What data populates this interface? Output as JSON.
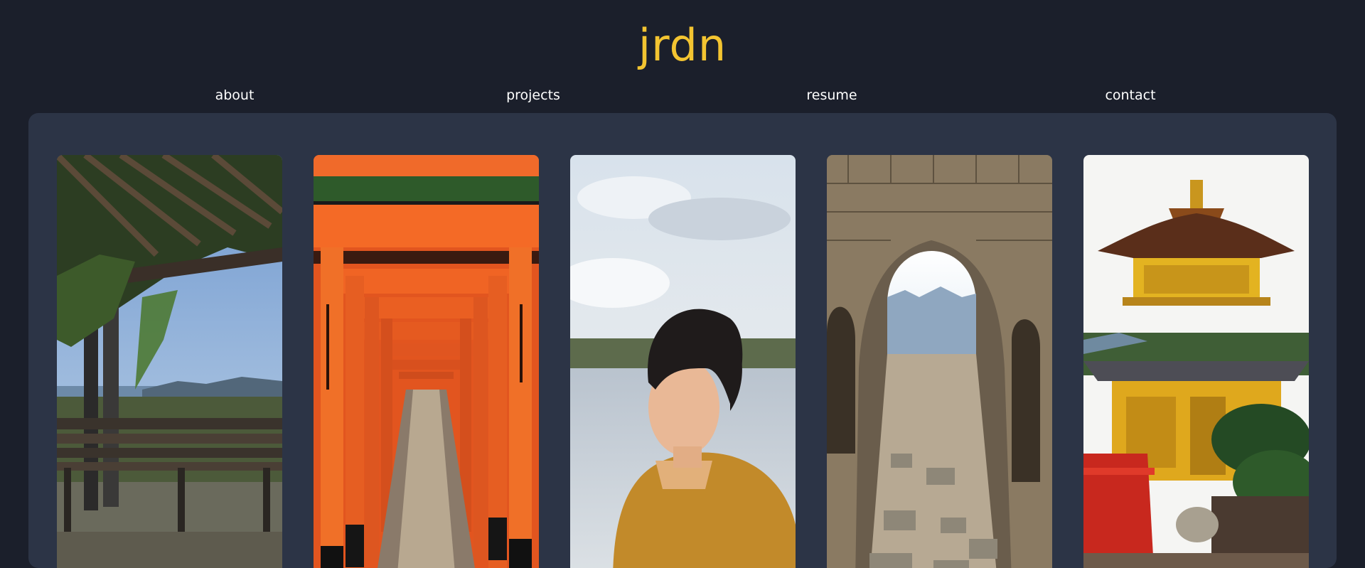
{
  "site": {
    "title": "jrdn"
  },
  "nav": {
    "items": [
      {
        "label": "about"
      },
      {
        "label": "projects"
      },
      {
        "label": "resume"
      },
      {
        "label": "contact"
      }
    ]
  },
  "gallery": {
    "photos": [
      {
        "icon": "pergola-bench-lake-photo"
      },
      {
        "icon": "torii-gates-corridor-photo"
      },
      {
        "icon": "portrait-by-water-photo"
      },
      {
        "icon": "stone-arch-ruins-photo"
      },
      {
        "icon": "golden-pagoda-photo"
      }
    ]
  },
  "colors": {
    "background": "#1b1f2b",
    "panel": "#2c3446",
    "accent": "#f3c431",
    "nav_text": "#ffffff"
  }
}
